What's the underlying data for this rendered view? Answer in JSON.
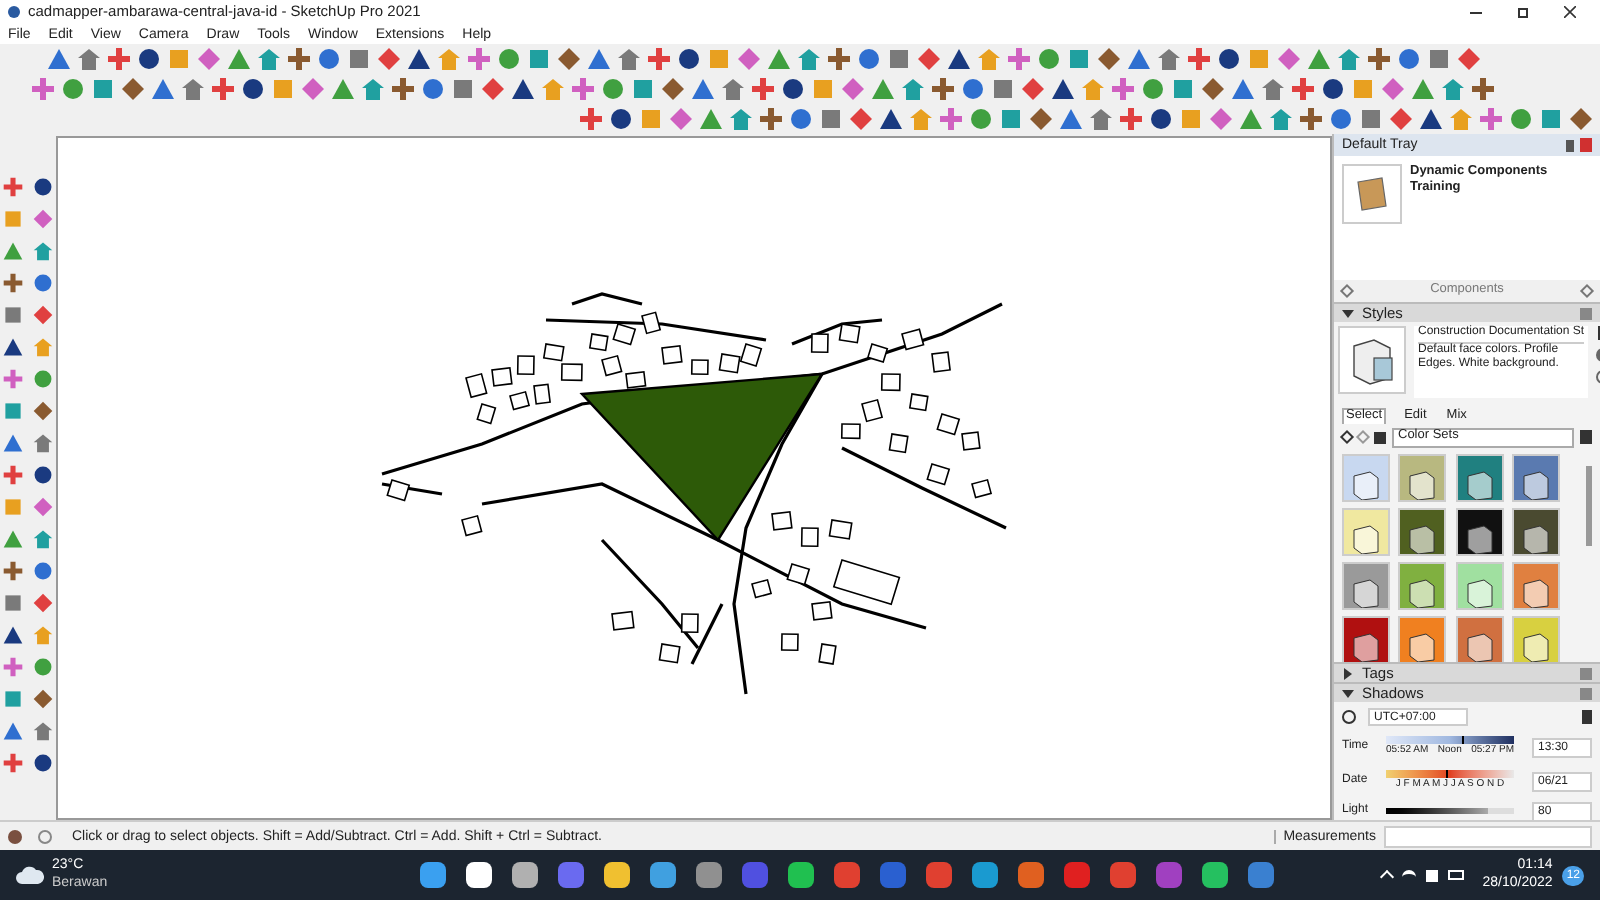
{
  "window": {
    "title": "cadmapper-ambarawa-central-java-id - SketchUp Pro 2021"
  },
  "menu": [
    "File",
    "Edit",
    "View",
    "Camera",
    "Draw",
    "Tools",
    "Window",
    "Extensions",
    "Help"
  ],
  "tray": {
    "title": "Default Tray",
    "components": {
      "name": "Dynamic Components Training",
      "label": "Components"
    },
    "styles": {
      "header": "Styles",
      "expanded": true,
      "style_name": "Construction Documentation St",
      "description": "Default face colors. Profile Edges. White background.",
      "tabs": [
        {
          "label": "Select",
          "selected": true
        },
        {
          "label": "Edit",
          "selected": false
        },
        {
          "label": "Mix",
          "selected": false
        }
      ],
      "collection": "Color Sets"
    },
    "tags": {
      "header": "Tags",
      "expanded": false
    },
    "shadows": {
      "header": "Shadows",
      "expanded": true,
      "timezone": "UTC+07:00",
      "time_label": "Time",
      "sunrise": "05:52 AM",
      "noon": "Noon",
      "sunset": "05:27 PM",
      "time_slider": {
        "level": 0.6
      },
      "date_slider": {
        "level": 0.47
      },
      "time": "13:30",
      "date_label": "Date",
      "months": "J F M A M J J A S O N D",
      "date": "06/21",
      "light_label": "Light",
      "light": {
        "level": 0.8
      },
      "light_value": "80"
    }
  },
  "status_bar": {
    "message": "Click or drag to select objects. Shift = Add/Subtract. Ctrl = Add. Shift + Ctrl = Subtract.",
    "measurements_label": "Measurements"
  },
  "taskbar": {
    "weather": {
      "temperature": "23°C",
      "condition": "Berawan"
    },
    "time": "01:14",
    "date": "28/10/2022",
    "notification_count": "12"
  }
}
